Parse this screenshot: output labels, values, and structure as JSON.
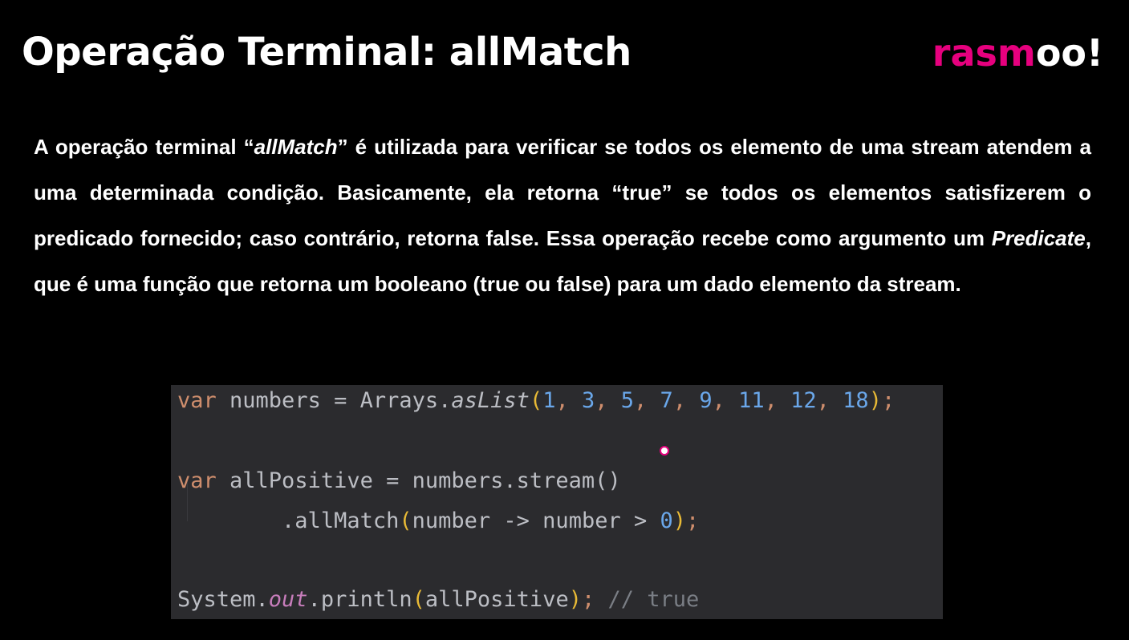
{
  "slide": {
    "title": "Operação Terminal: allMatch"
  },
  "logo": {
    "part1": "rasm",
    "part2": "oo!"
  },
  "description": {
    "s1": "A operação terminal “",
    "s1_italic": "allMatch",
    "s2": "” é utilizada para verificar se todos os elemento de uma stream atendem a uma determinada condição. Basicamente, ela retorna “true” se todos os elementos satisfizerem o predicado fornecido; caso contrário, retorna false. Essa operação recebe como argumento um ",
    "s2_italic": "Predicate",
    "s3": ", que é uma função que retorna um booleano (true ou false) para um dado elemento da stream."
  },
  "code": {
    "line1": {
      "kw": "var",
      "rest": " numbers = Arrays.",
      "method": "asList",
      "open": "(",
      "args": [
        "1",
        "3",
        "5",
        "7",
        "9",
        "11",
        "12",
        "18"
      ],
      "close": ")",
      "semi": ";"
    },
    "line2": {
      "kw": "var",
      "rest": " allPositive = numbers.stream()"
    },
    "line3": {
      "indent": "        ",
      "pre": ".allMatch",
      "open": "(",
      "body": "number -> number > ",
      "num": "0",
      "close": ")",
      "semi": ";"
    },
    "line4": {
      "pre": "System.",
      "field": "out",
      "post": ".println",
      "open": "(",
      "arg": "allPositive",
      "close": ")",
      "semi": ";",
      "comment": " // true"
    }
  },
  "colors": {
    "background": "#000000",
    "brand_pink": "#e6007e",
    "code_bg": "#2b2b2e"
  }
}
